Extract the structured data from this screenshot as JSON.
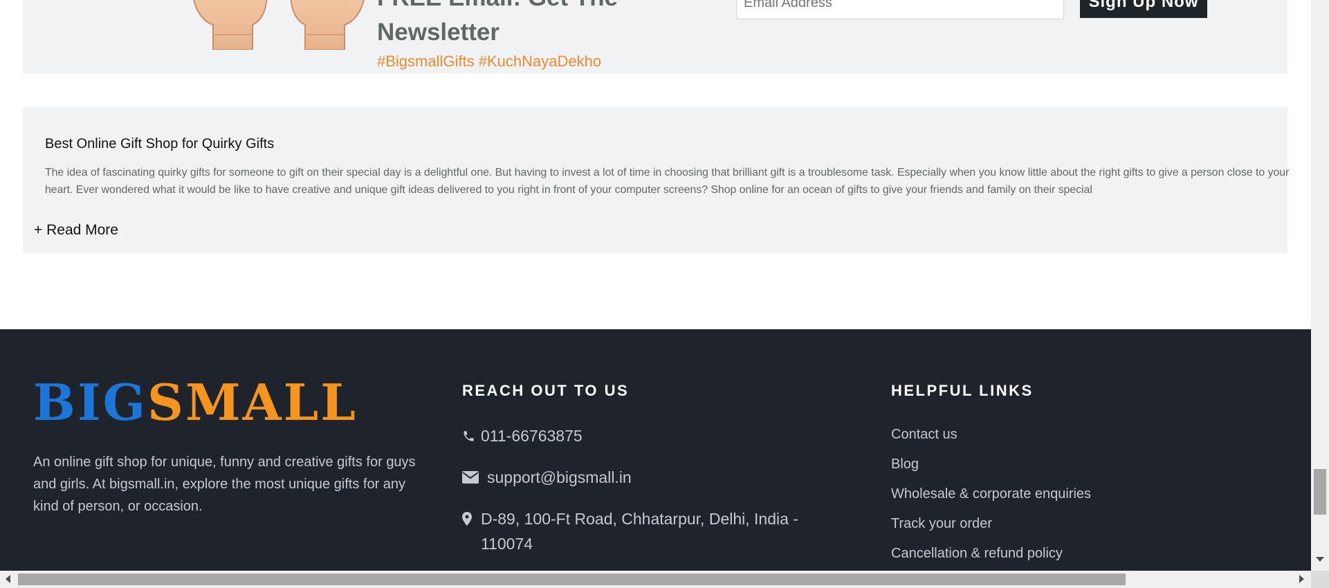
{
  "newsletter": {
    "title": "FREE Email: Get The Newsletter",
    "hashtags": "#BigsmallGifts #KuchNayaDekho",
    "email_placeholder": "Email Address",
    "signup_label": "Sign Up Now"
  },
  "seo_section": {
    "title": "Best Online Gift Shop for Quirky Gifts",
    "body": "The idea of fascinating quirky gifts for someone to gift on their special day is a delightful one. But having to invest a lot of time in choosing that brilliant gift is a troublesome task. Especially when you know little about the right gifts to give a person close to your heart. Ever wondered what it would be like to have creative and unique gift ideas delivered to you right in front of your computer screens? Shop online for an ocean of gifts to give your friends and family on their special",
    "read_more": "+ Read More"
  },
  "footer": {
    "logo": {
      "part1": "BIG",
      "part2": "SMALL",
      "color_big": "#1b76d8",
      "color_small": "#f5951d"
    },
    "about": "An online gift shop for unique, funny and creative gifts for guys and girls. At bigsmall.in, explore the most unique gifts for any kind of person, or occasion.",
    "reach_heading": "REACH OUT TO US",
    "phone": {
      "icon": "phone-icon",
      "text": "011-66763875"
    },
    "email": {
      "icon": "envelope-icon",
      "text": "support@bigsmall.in"
    },
    "address": {
      "icon": "map-pin-icon",
      "text": "D-89, 100-Ft Road, Chhatarpur, Delhi, India - 110074"
    },
    "links_heading": "HELPFUL LINKS",
    "links": [
      "Contact us",
      "Blog",
      "Wholesale & corporate enquiries",
      "Track your order",
      "Cancellation & refund policy"
    ]
  },
  "theme": {
    "panel_bg": "#f1f2f4",
    "footer_bg": "#1f242c",
    "accent_orange": "#ee8a2c",
    "button_bg": "#1f2429"
  }
}
